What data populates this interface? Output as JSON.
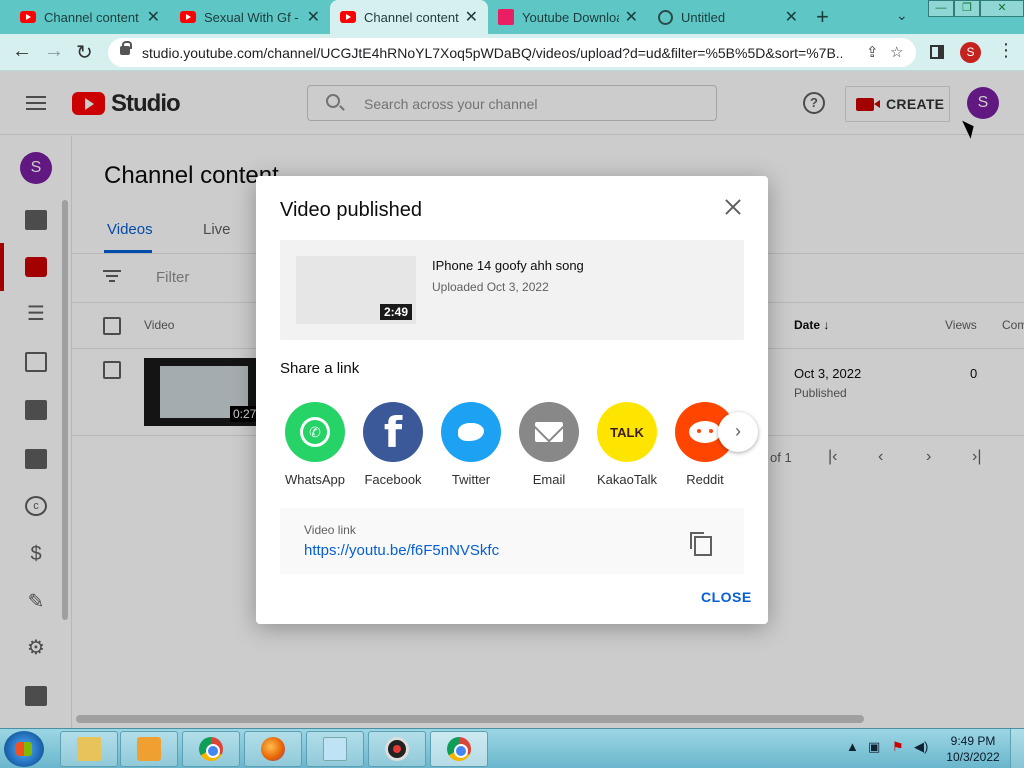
{
  "browser": {
    "tabs": [
      {
        "title": "Channel content",
        "icon": "youtube-icon"
      },
      {
        "title": "Sexual With Gf - Y",
        "icon": "youtube-icon"
      },
      {
        "title": "Channel content",
        "icon": "youtube-icon",
        "active": true
      },
      {
        "title": "Youtube Downloa",
        "icon": "download-icon"
      },
      {
        "title": "Untitled",
        "icon": "globe-icon"
      }
    ],
    "url": "studio.youtube.com/channel/UCGJtE4hRNoYL7Xoq5pWDaBQ/videos/upload?d=ud&filter=%5B%5D&sort=%7B...",
    "profile_initial": "S"
  },
  "studio": {
    "logo_text": "Studio",
    "search_placeholder": "Search across your channel",
    "create_label": "CREATE",
    "avatar_initial": "S",
    "page_title": "Channel content",
    "tabs": [
      "Videos",
      "Live"
    ],
    "filter_label": "Filter",
    "columns": {
      "video": "Video",
      "date": "Date ↓",
      "views": "Views",
      "comments": "Com"
    },
    "row": {
      "duration": "0:27",
      "date": "Oct 3, 2022",
      "status": "Published",
      "views": "0"
    },
    "pagination_text": "of 1"
  },
  "dialog": {
    "title": "Video published",
    "video": {
      "title": "IPhone 14 goofy ahh song",
      "uploaded": "Uploaded Oct 3, 2022",
      "duration": "2:49"
    },
    "share_heading": "Share a link",
    "share_options": [
      {
        "label": "WhatsApp",
        "icon": "whatsapp-icon",
        "color": "#25d366"
      },
      {
        "label": "Facebook",
        "icon": "facebook-icon",
        "color": "#3b5998"
      },
      {
        "label": "Twitter",
        "icon": "twitter-icon",
        "color": "#1da1f2"
      },
      {
        "label": "Email",
        "icon": "email-icon",
        "color": "#888888"
      },
      {
        "label": "KakaoTalk",
        "icon": "kakaotalk-icon",
        "color": "#fee500"
      },
      {
        "label": "Reddit",
        "icon": "reddit-icon",
        "color": "#ff4500"
      }
    ],
    "facebook_glyph": "f",
    "kakao_glyph": "TALK",
    "link_label": "Video link",
    "link_url": "https://youtu.be/f6F5nNVSkfc",
    "close_label": "CLOSE"
  },
  "taskbar": {
    "time": "9:49 PM",
    "date": "10/3/2022"
  },
  "colors": {
    "accent": "#065fd4",
    "brand_red": "#ff0000",
    "browser_frame": "#5ec7c5"
  }
}
